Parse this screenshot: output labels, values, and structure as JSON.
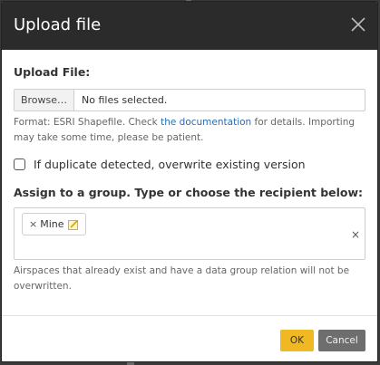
{
  "dialog": {
    "title": "Upload file"
  },
  "upload": {
    "label": "Upload File:",
    "browse_label": "Browse…",
    "file_status": "No files selected.",
    "hint_prefix": "Format: ESRI Shapefile. Check ",
    "hint_link": "the documentation",
    "hint_suffix": " for details. Importing may take some time, please be patient."
  },
  "overwrite": {
    "checked": false,
    "label": "If duplicate detected, overwrite existing version"
  },
  "assign": {
    "label": "Assign to a group. Type or choose the recipient below:",
    "tags": [
      {
        "label": "Mine"
      }
    ],
    "remove_glyph": "×",
    "clear_glyph": "×",
    "hint": "Airspaces that already exist and have a data group relation will not be overwritten."
  },
  "footer": {
    "ok_label": "OK",
    "cancel_label": "Cancel"
  },
  "colors": {
    "header_bg": "#2b2b2b",
    "ok_bg": "#f0b823",
    "cancel_bg": "#6e6e6e",
    "link": "#2a6db3"
  },
  "icons": {
    "close": "close-icon",
    "edit": "edit-icon"
  }
}
